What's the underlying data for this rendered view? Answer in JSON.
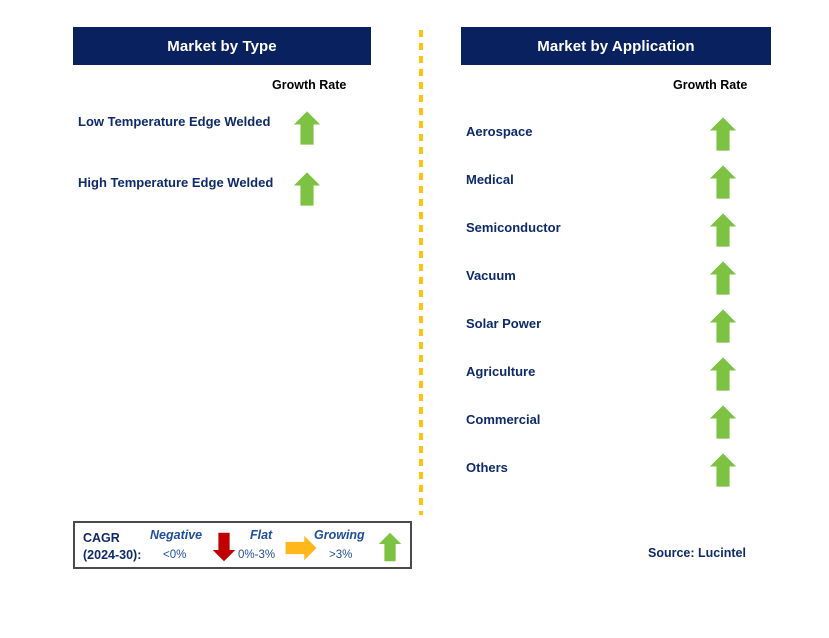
{
  "colors": {
    "header_navy": "#0a2160",
    "label_navy": "#0e2a6b",
    "growing_green": "#7dc242",
    "negative_red": "#c00000",
    "flat_orange": "#ffb81c",
    "divider_orange": "#ffc20e",
    "legend_text_blue": "#1f4e9c"
  },
  "panels": {
    "left": {
      "header_title": "Market by Type",
      "growth_caption": "Growth Rate",
      "rows": [
        {
          "label": "Low Temperature Edge Welded",
          "trend": "growing",
          "icon": "arrow-up-icon"
        },
        {
          "label": "High Temperature Edge Welded",
          "trend": "growing",
          "icon": "arrow-up-icon"
        }
      ]
    },
    "right": {
      "header_title": "Market by Application",
      "growth_caption": "Growth Rate",
      "rows": [
        {
          "label": "Aerospace",
          "trend": "growing",
          "icon": "arrow-up-icon"
        },
        {
          "label": "Medical",
          "trend": "growing",
          "icon": "arrow-up-icon"
        },
        {
          "label": "Semiconductor",
          "trend": "growing",
          "icon": "arrow-up-icon"
        },
        {
          "label": "Vacuum",
          "trend": "growing",
          "icon": "arrow-up-icon"
        },
        {
          "label": "Solar Power",
          "trend": "growing",
          "icon": "arrow-up-icon"
        },
        {
          "label": "Agriculture",
          "trend": "growing",
          "icon": "arrow-up-icon"
        },
        {
          "label": "Commercial",
          "trend": "growing",
          "icon": "arrow-up-icon"
        },
        {
          "label": "Others",
          "trend": "growing",
          "icon": "arrow-up-icon"
        }
      ]
    }
  },
  "legend": {
    "cagr_line1": "CAGR",
    "cagr_line2": "(2024-30):",
    "items": [
      {
        "term": "Negative",
        "range": "<0%",
        "icon": "arrow-down-icon",
        "color": "#c00000"
      },
      {
        "term": "Flat",
        "range": "0%-3%",
        "icon": "arrow-right-icon",
        "color": "#ffb81c"
      },
      {
        "term": "Growing",
        "range": ">3%",
        "icon": "arrow-up-icon",
        "color": "#7dc242"
      }
    ]
  },
  "source": "Source: Lucintel"
}
